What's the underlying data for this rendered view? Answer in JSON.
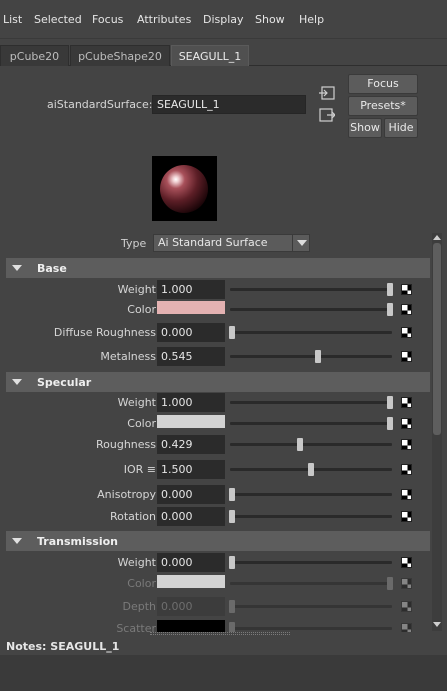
{
  "menu": [
    "List",
    "Selected",
    "Focus",
    "Attributes",
    "Display",
    "Show",
    "Help"
  ],
  "tabs": [
    {
      "label": "pCube20",
      "active": false
    },
    {
      "label": "pCubeShape20",
      "active": false
    },
    {
      "label": "SEAGULL_1",
      "active": true
    }
  ],
  "node": {
    "type_label": "aiStandardSurface:",
    "name": "SEAGULL_1"
  },
  "buttons": {
    "focus": "Focus",
    "presets": "Presets*",
    "show": "Show",
    "hide": "Hide"
  },
  "type": {
    "label": "Type",
    "value": "Ai Standard Surface"
  },
  "sections": {
    "base": {
      "title": "Base",
      "rows": [
        {
          "label": "Weight",
          "value": "1.000",
          "slider": 1.0
        },
        {
          "label": "Color",
          "color": "#e4b2b2",
          "slider": 1.0
        },
        {
          "label": "Diffuse Roughness",
          "value": "0.000",
          "slider": 0.0
        },
        {
          "label": "Metalness",
          "value": "0.545",
          "slider": 0.545
        }
      ]
    },
    "specular": {
      "title": "Specular",
      "rows": [
        {
          "label": "Weight",
          "value": "1.000",
          "slider": 1.0
        },
        {
          "label": "Color",
          "color": "#d2d2d2",
          "slider": 1.0
        },
        {
          "label": "Roughness",
          "value": "0.429",
          "slider": 0.429
        },
        {
          "label": "IOR ≡",
          "value": "1.500",
          "slider": 0.5
        },
        {
          "label": "Anisotropy",
          "value": "0.000",
          "slider": 0.0
        },
        {
          "label": "Rotation",
          "value": "0.000",
          "slider": 0.0
        }
      ]
    },
    "transmission": {
      "title": "Transmission",
      "rows": [
        {
          "label": "Weight",
          "value": "0.000",
          "slider": 0.0
        },
        {
          "label": "Color",
          "color": "#d2d2d2",
          "slider": 1.0
        },
        {
          "label": "Depth",
          "value": "0.000",
          "slider": 0.0
        },
        {
          "label": "Scatter",
          "color": "#000000",
          "slider": 0.0
        }
      ]
    }
  },
  "notes": {
    "label": "Notes:",
    "node": "SEAGULL_1"
  }
}
